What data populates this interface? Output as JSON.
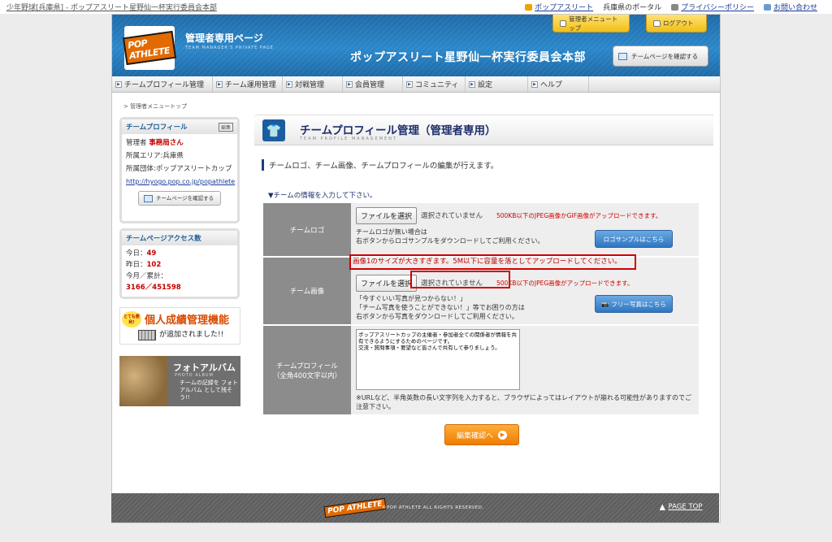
{
  "topbar": {
    "breadcrumb": "少年野球[兵庫県] - ポップアスリート星野仙一杯実行委員会本部",
    "links": [
      "ポップアスリート",
      "兵庫県のポータル",
      "プライバシーポリシー",
      "お問い合わせ"
    ]
  },
  "header": {
    "logo_text": "POP ATHLETE",
    "title": "管理者専用ページ",
    "subtitle": "TEAM MANAGER'S PRIVATE PAGE",
    "org": "ポップアスリート星野仙一杯実行委員会本部",
    "menu_top": "管理者メニュートップ",
    "logout": "ログアウト",
    "confirm_page": "チームページを確認する"
  },
  "nav": [
    "チームプロフィール管理",
    "チーム運用管理",
    "対戦管理",
    "会員管理",
    "コミュニティ",
    "設定",
    "ヘルプ"
  ],
  "breadcrumb": "> 管理者メニュートップ",
  "sidebar": {
    "profile": {
      "heading": "チームプロフィール",
      "edit": "編集",
      "manager_label": "管理者",
      "manager_name": "事務局さん",
      "area": "所属エリア:兵庫県",
      "group": "所属団体:ポップアスリートカップ",
      "url": "http://hyogo.pop.co.jp/popathlete",
      "confirm_btn": "チームページを確認する"
    },
    "access": {
      "heading": "チームページアクセス数",
      "today_label": "今日：",
      "today": "49",
      "yesterday_label": "昨日：",
      "yesterday": "102",
      "month_label": "今月／累計：",
      "month_total": "3166／451598"
    },
    "banner1": {
      "badge": "とても便利!",
      "title": "個人成績管理機能",
      "line": "が追加されました!!"
    },
    "banner2": {
      "title": "フォトアルバム",
      "sub": "PHOTO ALBUM",
      "text": "チームの記録を フォトアルバム として残そう!!"
    }
  },
  "main": {
    "title": "チームプロフィール管理（管理者専用）",
    "subtitle": "TEAM PROFILE MANAGEMENT",
    "intro": "チームロゴ、チーム画像、チームプロフィールの編集が行えます。",
    "section": "▼チームの情報を入力して下さい。",
    "rows": {
      "logo": {
        "label": "チームロゴ",
        "file_button": "ファイルを選択",
        "no_file": "選択されていません",
        "note": "500KB以下のJPEG画像かGIF画像がアップロードできます。",
        "help1": "チームロゴが無い場合は",
        "help2": "右ボタンからロゴサンプルをダウンロードしてご利用ください。",
        "sample_btn": "ロゴサンプルはこちら"
      },
      "image": {
        "label": "チーム画像",
        "error": "画像1のサイズが大きすぎます。5M以下に容量を落としてアップロードしてください。",
        "file_button": "ファイルを選択",
        "no_file": "選択されていません",
        "note": "500KB以下のJPEG画像がアップロードできます。",
        "help1": "「今すぐいい写真が見つからない！」",
        "help2": "「チーム写真を使うことができない！」等でお困りの方は",
        "help3": "右ボタンから写真をダウンロードしてご利用ください。",
        "free_btn": "フリー写真はこちら"
      },
      "profile": {
        "label": "チームプロフィール",
        "label2": "（全角400文字以内）",
        "text": "ポップアスリートカップの主催者・参加者全ての関係者が情報を共有できるようにするためのページです。\n交流・質問事項・要望など皆さんで共有して参りましょう。",
        "note": "※URLなど、半角英数の長い文字列を入力すると、ブラウザによってはレイアウトが崩れる可能性がありますのでご注意下さい。"
      }
    },
    "submit": "編集確認へ"
  },
  "footer": {
    "logo": "POP ATHLETE",
    "copyright": "©POP ATHLETE ALL RIGHTS RESERVED.",
    "pagetop": "PAGE TOP"
  },
  "colors": {
    "header_blue": "#2a87c9",
    "accent_orange": "#ef7d00",
    "error_red": "#d10000"
  }
}
